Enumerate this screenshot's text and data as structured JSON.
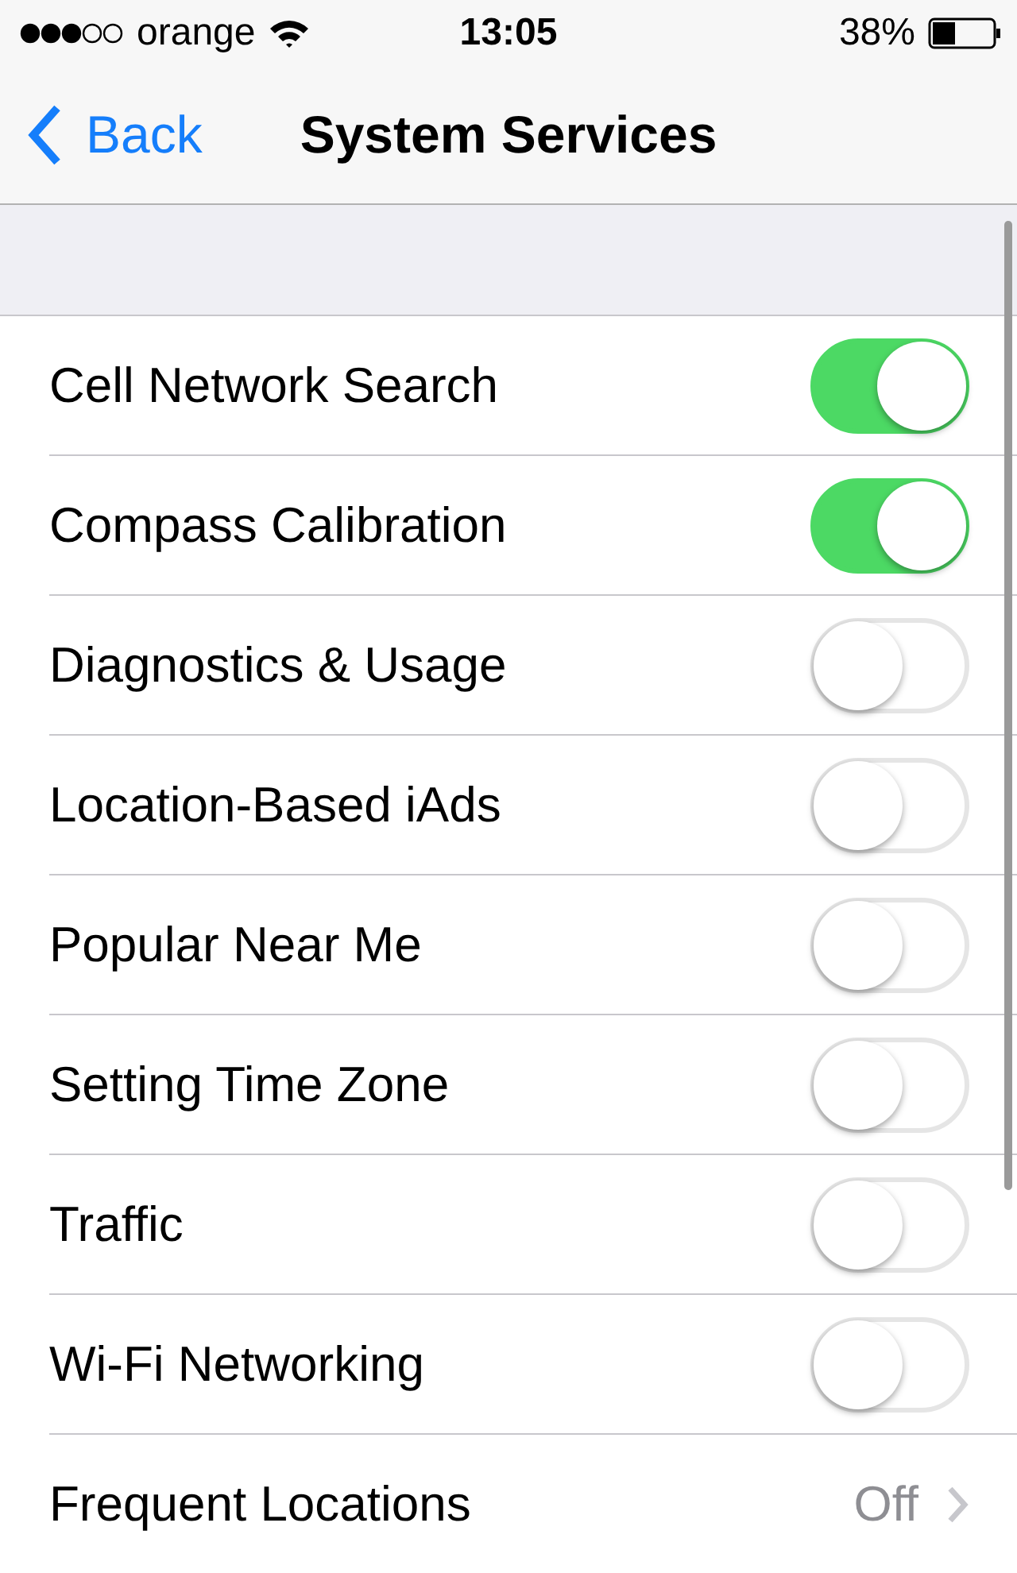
{
  "status_bar": {
    "carrier": "orange",
    "time": "13:05",
    "battery": "38%"
  },
  "nav": {
    "back": "Back",
    "title": "System Services"
  },
  "rows": [
    {
      "kind": "toggle",
      "label": "Cell Network Search",
      "on": true
    },
    {
      "kind": "toggle",
      "label": "Compass Calibration",
      "on": true
    },
    {
      "kind": "toggle",
      "label": "Diagnostics & Usage",
      "on": false
    },
    {
      "kind": "toggle",
      "label": "Location-Based iAds",
      "on": false
    },
    {
      "kind": "toggle",
      "label": "Popular Near Me",
      "on": false
    },
    {
      "kind": "toggle",
      "label": "Setting Time Zone",
      "on": false
    },
    {
      "kind": "toggle",
      "label": "Traffic",
      "on": false
    },
    {
      "kind": "toggle",
      "label": "Wi-Fi Networking",
      "on": false
    },
    {
      "kind": "disclosure",
      "label": "Frequent Locations",
      "value": "Off"
    }
  ]
}
